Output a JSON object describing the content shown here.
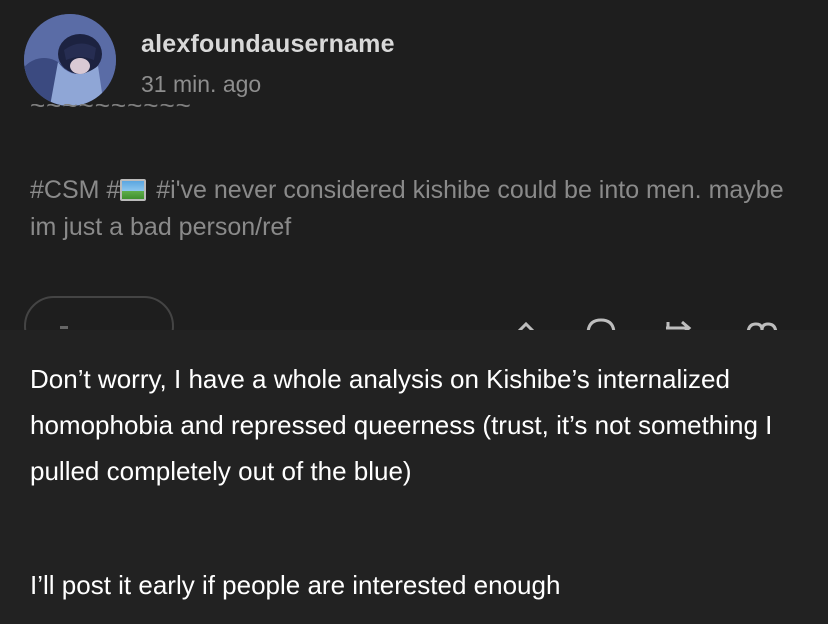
{
  "post": {
    "username": "alexfoundausername",
    "timestamp": "31 min. ago",
    "tags_prefix": "#CSM #",
    "image_tag_icon": "image-icon",
    "tags_rest": " #i've never considered kishibe could be into men. maybe im just a bad person/ref"
  },
  "actions": {
    "icons": [
      "share-icon",
      "comment-icon",
      "reblog-icon",
      "like-icon"
    ]
  },
  "reply": {
    "paragraph1": "Don’t worry, I have a whole analysis on Kishibe’s internalized homophobia and repressed queerness (trust, it’s not something I pulled completely out of the blue)",
    "paragraph2": "I’ll post it early if people are interested enough"
  }
}
